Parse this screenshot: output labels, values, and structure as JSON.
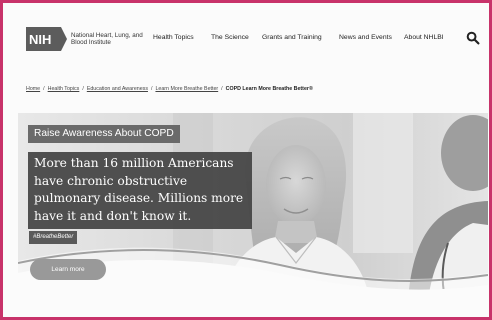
{
  "header": {
    "logo_mark": "NIH",
    "logo_text": "National Heart, Lung, and Blood Institute",
    "nav": [
      "Health Topics",
      "The Science",
      "Grants and Training",
      "News and Events",
      "About NHLBI"
    ],
    "search_icon": "search-icon"
  },
  "breadcrumb": {
    "items": [
      "Home",
      "Health Topics",
      "Education and Awareness",
      "Learn More Breathe Better"
    ],
    "separator": "/",
    "current": "COPD Learn More Breathe Better®"
  },
  "hero": {
    "badge": "Raise Awareness About COPD",
    "headline": "More than 16 million Americans have chronic obstructive pulmonary disease. Millions more have it and don't know it.",
    "hashtag": "#BreatheBetter",
    "button_label": "Learn more"
  },
  "colors": {
    "frame_border": "#c8336a",
    "logo_bg": "#5c5c5c",
    "hero_text_bg": "#444444",
    "button_bg": "#999999"
  }
}
